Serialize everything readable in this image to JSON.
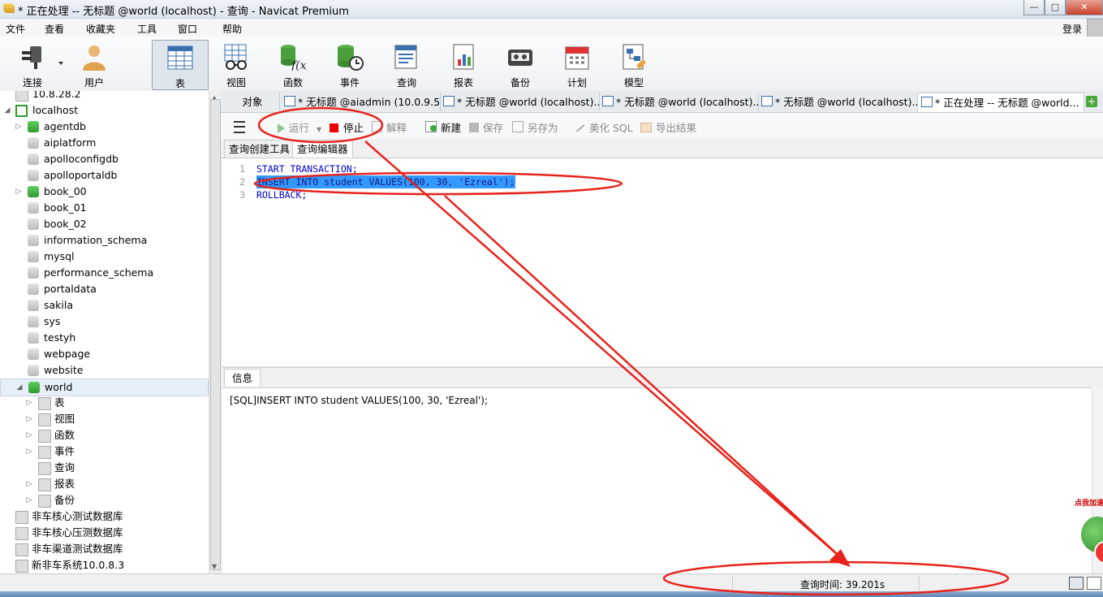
{
  "window": {
    "title": "* 正在处理 -- 无标题 @world (localhost) - 查询 - Navicat Premium",
    "login_label": "登录",
    "controls": {
      "minimize": "—",
      "maximize": "□",
      "close": "✕"
    }
  },
  "menubar": {
    "items": [
      "文件",
      "查看",
      "收藏夹",
      "工具",
      "窗口",
      "帮助"
    ]
  },
  "toolbar": {
    "items": [
      {
        "label": "连接",
        "icon": "plug-icon"
      },
      {
        "label": "用户",
        "icon": "user-icon"
      },
      {
        "label": "表",
        "icon": "table-icon",
        "selected": true
      },
      {
        "label": "视图",
        "icon": "view-glasses-icon"
      },
      {
        "label": "函数",
        "icon": "function-icon"
      },
      {
        "label": "事件",
        "icon": "event-clock-icon"
      },
      {
        "label": "查询",
        "icon": "query-icon"
      },
      {
        "label": "报表",
        "icon": "report-icon"
      },
      {
        "label": "备份",
        "icon": "backup-icon"
      },
      {
        "label": "计划",
        "icon": "calendar-icon"
      },
      {
        "label": "模型",
        "icon": "model-icon"
      }
    ]
  },
  "sidebar": {
    "partial_top": "10.8.28.2",
    "connection": "localhost",
    "databases": [
      {
        "name": "agentdb",
        "open": true,
        "expandable": true
      },
      {
        "name": "aiplatform",
        "open": false
      },
      {
        "name": "apolloconfigdb",
        "open": false
      },
      {
        "name": "apolloportaldb",
        "open": false
      },
      {
        "name": "book_00",
        "open": true,
        "expandable": true
      },
      {
        "name": "book_01",
        "open": false
      },
      {
        "name": "book_02",
        "open": false
      },
      {
        "name": "information_schema",
        "open": false
      },
      {
        "name": "mysql",
        "open": false
      },
      {
        "name": "performance_schema",
        "open": false
      },
      {
        "name": "portaldata",
        "open": false
      },
      {
        "name": "sakila",
        "open": false
      },
      {
        "name": "sys",
        "open": false
      },
      {
        "name": "testyh",
        "open": false
      },
      {
        "name": "webpage",
        "open": false
      },
      {
        "name": "website",
        "open": false
      },
      {
        "name": "world",
        "open": true,
        "expandable": true,
        "selected": true
      }
    ],
    "world_children": [
      {
        "name": "表",
        "icon": "table-icon"
      },
      {
        "name": "视图",
        "icon": "view-glasses-icon"
      },
      {
        "name": "函数",
        "icon": "function-icon"
      },
      {
        "name": "事件",
        "icon": "event-clock-icon"
      },
      {
        "name": "查询",
        "icon": "query-icon"
      },
      {
        "name": "报表",
        "icon": "report-icon"
      },
      {
        "name": "备份",
        "icon": "backup-icon"
      }
    ],
    "other_connections": [
      "非车核心测试数据库",
      "非车核心压测数据库",
      "非车渠道测试数据库",
      "新非车系统10.0.8.3"
    ]
  },
  "tabs": {
    "objects_label": "对象",
    "items": [
      {
        "label": "* 无标题 @aiadmin (10.0.9.5..."
      },
      {
        "label": "* 无标题 @world (localhost)..."
      },
      {
        "label": "* 无标题 @world (localhost)..."
      },
      {
        "label": "* 无标题 @world (localhost)..."
      },
      {
        "label": "* 正在处理 -- 无标题 @world..."
      }
    ]
  },
  "query_toolbar": {
    "run": "运行",
    "stop": "停止",
    "explain": "解释",
    "new": "新建",
    "save": "保存",
    "save_as": "另存为",
    "beautify": "美化 SQL",
    "export": "导出结果"
  },
  "subtabs": {
    "builder": "查询创建工具",
    "editor": "查询编辑器"
  },
  "editor": {
    "lines": [
      {
        "num": "1",
        "code": "START TRANSACTION;"
      },
      {
        "num": "2",
        "code": "INSERT INTO student VALUES(100, 30, 'Ezreal');"
      },
      {
        "num": "3",
        "code": "ROLLBACK;"
      }
    ]
  },
  "info": {
    "tab_label": "信息",
    "message": "[SQL]INSERT INTO student VALUES(100, 30, 'Ezreal');"
  },
  "statusbar": {
    "query_time": "查询时间: 39.201s"
  },
  "widget": {
    "label": "点我加速"
  },
  "colors": {
    "annotation": "#e8231b",
    "selection": "#3399ff",
    "sql_keyword": "#0000cc"
  }
}
